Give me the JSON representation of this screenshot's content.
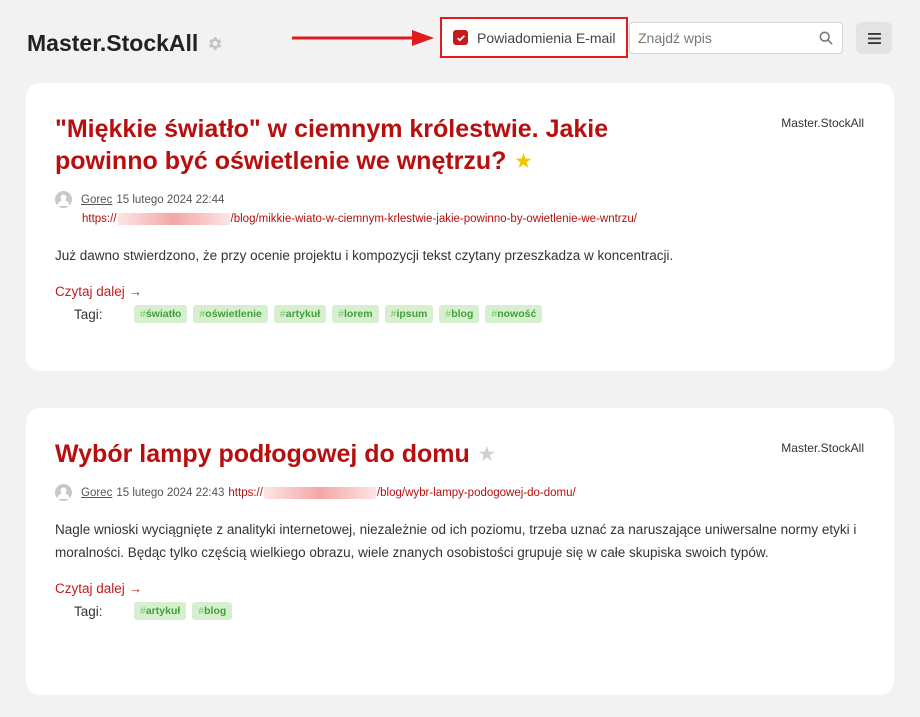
{
  "header": {
    "site_title": "Master.StockAll",
    "notify_label": "Powiadomienia E-mail",
    "search_placeholder": "Znajdź wpis"
  },
  "posts": [
    {
      "title": "\"Miękkie światło\" w ciemnym królestwie. Jakie powinno być oświetlenie we wnętrzu?",
      "featured": true,
      "source": "Master.StockAll",
      "author": "Gorec",
      "date": "15 lutego 2024 22:44",
      "url_prefix": "https://",
      "url_suffix": "/blog/mikkie-wiato-w-ciemnym-krlestwie-jakie-powinno-by-owietlenie-we-wntrzu/",
      "excerpt": "Już dawno stwierdzono, że przy ocenie projektu i kompozycji tekst czytany przeszkadza w koncentracji.",
      "read_more": "Czytaj dalej →",
      "tags_label": "Tagi:",
      "tags": [
        "światło",
        "oświetlenie",
        "artykuł",
        "lorem",
        "ipsum",
        "blog",
        "nowość"
      ]
    },
    {
      "title": "Wybór lampy podłogowej do domu",
      "featured": false,
      "source": "Master.StockAll",
      "author": "Gorec",
      "date": "15 lutego 2024 22:43",
      "url_prefix": "https://",
      "url_suffix": "/blog/wybr-lampy-podogowej-do-domu/",
      "excerpt": "Nagle wnioski wyciągnięte z analityki internetowej, niezależnie od ich poziomu, trzeba uznać za naruszające uniwersalne normy etyki i moralności. Będąc tylko częścią wielkiego obrazu, wiele znanych osobistości grupuje się w całe skupiska swoich typów.",
      "read_more": "Czytaj dalej →",
      "tags_label": "Tagi:",
      "tags": [
        "artykuł",
        "blog"
      ]
    }
  ],
  "colors": {
    "accent": "#b80e0e",
    "tag_bg": "#d6f0cf",
    "tag_text": "#41a03a",
    "star_active": "#f5c400",
    "highlight_frame": "#e01b1b"
  },
  "icons": [
    "gear-icon",
    "arrow-icon",
    "checkbox-checked-icon",
    "search-icon",
    "menu-icon",
    "star-icon",
    "avatar-icon"
  ]
}
